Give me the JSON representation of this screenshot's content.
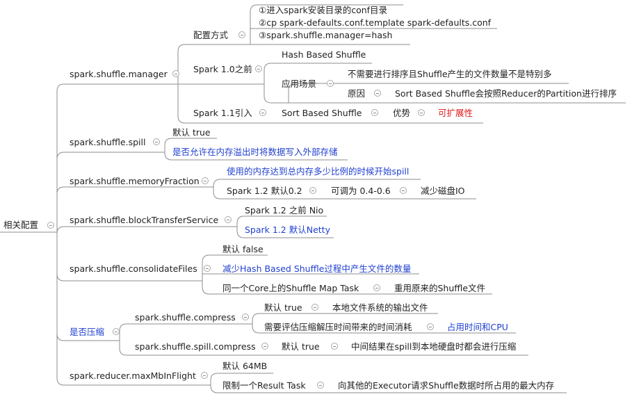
{
  "root": "相关配置",
  "manager": {
    "label": "spark.shuffle.manager",
    "config_method": "配置方式",
    "steps": [
      "①进入spark安装目录的conf目录",
      "②cp spark-defaults.conf.template spark-defaults.conf",
      "③spark.shuffle.manager=hash"
    ],
    "before10": "Spark 1.0之前",
    "hash_based": "Hash Based Shuffle",
    "scenario": "应用场景",
    "scenario_detail": "不需要进行排序且Shuffle产生的文件数量不是特别多",
    "reason": "原因",
    "reason_detail": "Sort Based Shuffle会按照Reducer的Partition进行排序",
    "since11": "Spark 1.1引入",
    "sort_based": "Sort Based Shuffle",
    "advantage": "优势",
    "advantage_detail": "可扩展性"
  },
  "spill": {
    "label": "spark.shuffle.spill",
    "default": "默认 true",
    "desc": "是否允许在内存溢出时将数据写入外部存储"
  },
  "memoryFraction": {
    "label": "spark.shuffle.memoryFraction",
    "desc": "使用的内存达到总内存多少比例的时候开始spill",
    "default": "Spark 1.2 默认0.2",
    "adjust": "可调为 0.4-0.6",
    "effect": "减少磁盘IO"
  },
  "blockTransfer": {
    "label": "spark.shuffle.blockTransferService",
    "before12": "Spark 1.2 之前 Nio",
    "default12": "Spark 1.2 默认Netty"
  },
  "consolidate": {
    "label": "spark.shuffle.consolidateFiles",
    "default": "默认 false",
    "desc": "减少Hash Based Shuffle过程中产生文件的数量",
    "same_core": "同一个Core上的Shuffle Map Task",
    "reuse": "重用原来的Shuffle文件"
  },
  "compress": {
    "label": "是否压缩",
    "shuffle_compress": "spark.shuffle.compress",
    "sc_default": "默认 true",
    "sc_default_detail": "本地文件系统的输出文件",
    "sc_eval": "需要评估压缩解压时间带来的时间消耗",
    "sc_eval_detail": "占用时间和CPU",
    "spill_compress": "spark.shuffle.spill.compress",
    "spc_default": "默认 true",
    "spc_detail": "中间结果在spill到本地硬盘时都会进行压缩"
  },
  "maxMb": {
    "label": "spark.reducer.maxMbInFlight",
    "default": "默认 64MB",
    "limit": "限制一个Result Task",
    "limit_detail": "向其他的Executor请求Shuffle数据时所占用的最大内存"
  }
}
